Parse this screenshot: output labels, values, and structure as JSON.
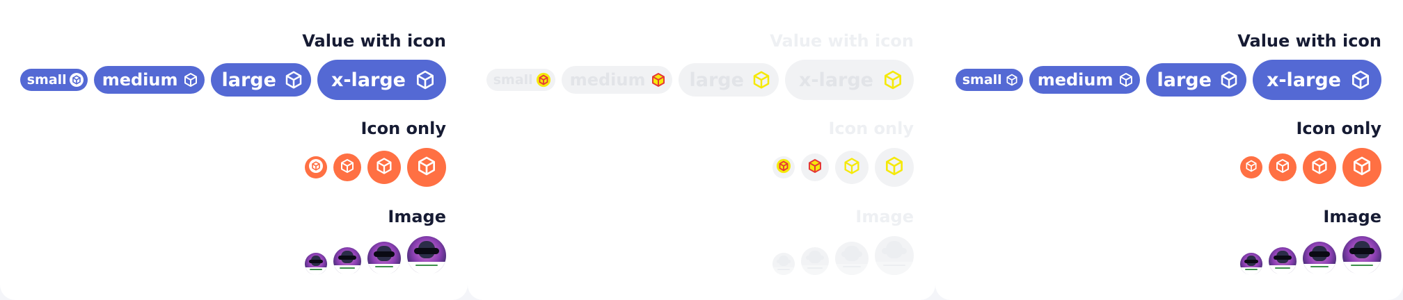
{
  "sections": {
    "value_with_icon": "Value with icon",
    "icon_only": "Icon only",
    "image": "Image"
  },
  "badges": {
    "small": "small",
    "medium": "medium",
    "large": "large",
    "x_large": "x-large"
  },
  "icon_name": "cube-icon",
  "colors": {
    "badge_bg": "#5469d4",
    "icon_bg": "#ff7043",
    "title": "#161b33",
    "disabled_bg": "#f1f2f4",
    "disabled_icon_stroke": "#f5e90a",
    "disabled_icon_red": "#e53935"
  },
  "panels": [
    {
      "state": "enabled"
    },
    {
      "state": "disabled"
    },
    {
      "state": "enabled"
    }
  ]
}
